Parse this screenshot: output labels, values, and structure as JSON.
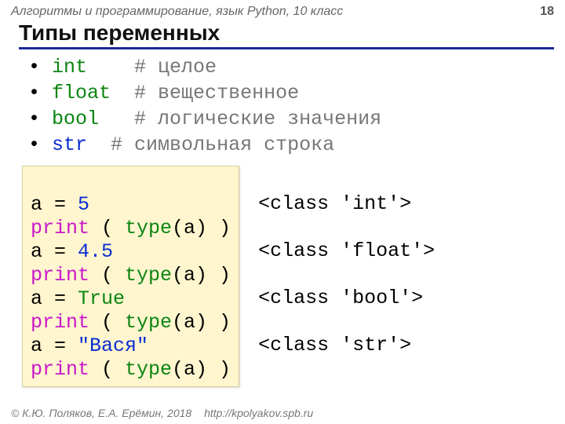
{
  "header": {
    "course": "Алгоритмы и программирование, язык Python, 10 класс",
    "page": "18"
  },
  "title": "Типы переменных",
  "bullets": [
    {
      "kw": "int",
      "kw_color": "grn",
      "pad": "    ",
      "comment": "# целое"
    },
    {
      "kw": "float",
      "kw_color": "grn",
      "pad": "  ",
      "comment": "# вещественное"
    },
    {
      "kw": "bool",
      "kw_color": "grn",
      "pad": "   ",
      "comment": "# логические значения"
    },
    {
      "kw": "str",
      "kw_color": "blu",
      "pad": "  ",
      "comment": "# символьная строка"
    }
  ],
  "code": {
    "l1_a": "a",
    "l1_eq": " = ",
    "l1_v": "5",
    "l2_p": "print",
    "l2_open": " ( ",
    "l2_t": "type",
    "l2_arg": "(a) )",
    "l3_a": "a",
    "l3_eq": " = ",
    "l3_v": "4.5",
    "l4_p": "print",
    "l4_open": " ( ",
    "l4_t": "type",
    "l4_arg": "(a) )",
    "l5_a": "a",
    "l5_eq": " = ",
    "l5_v": "True",
    "l6_p": "print",
    "l6_open": " ( ",
    "l6_t": "type",
    "l6_arg": "(a) )",
    "l7_a": "a",
    "l7_eq": " = ",
    "l7_v": "\"Вася\"",
    "l8_p": "print",
    "l8_open": " ( ",
    "l8_t": "type",
    "l8_arg": "(a) )"
  },
  "output": {
    "o1": "<class 'int'>",
    "o2": "<class 'float'>",
    "o3": "<class 'bool'>",
    "o4": "<class 'str'>"
  },
  "footer": {
    "copyright": "© К.Ю. Поляков, Е.А. Ерёмин, 2018",
    "url": "http://kpolyakov.spb.ru"
  }
}
